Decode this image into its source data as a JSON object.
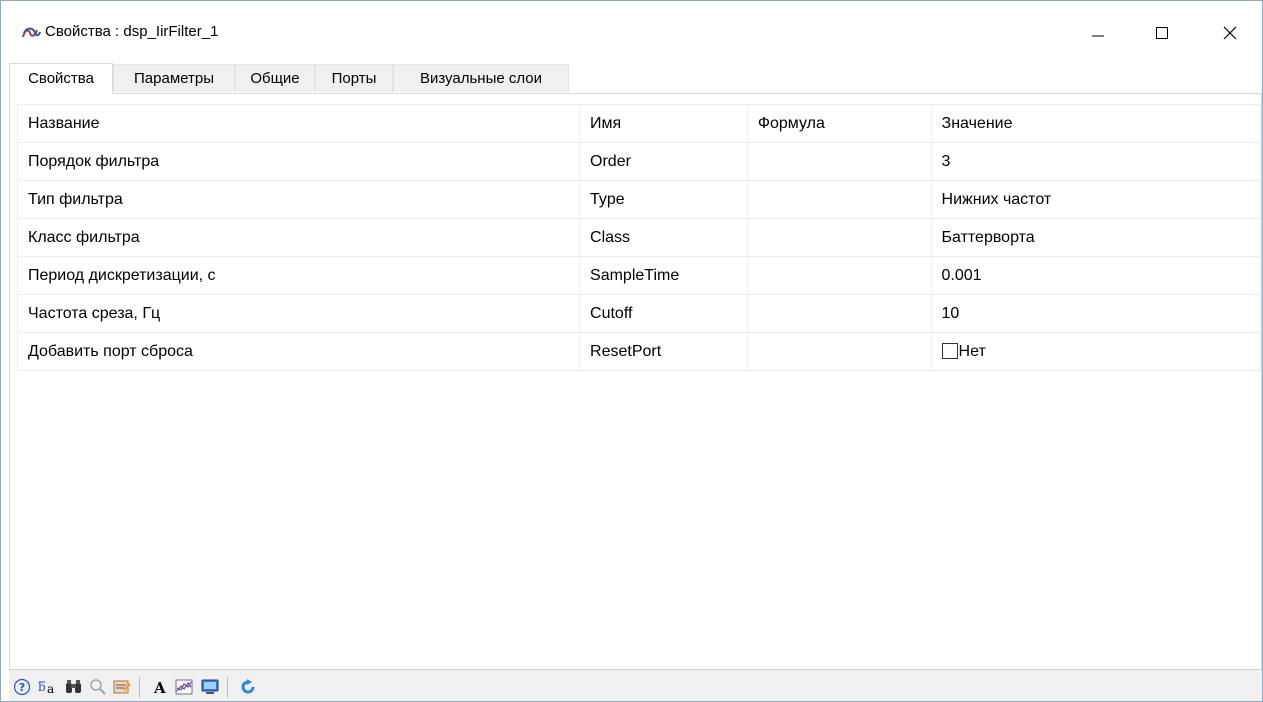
{
  "window": {
    "title": "Свойства : dsp_IirFilter_1"
  },
  "tabs": [
    {
      "label": "Свойства",
      "active": true
    },
    {
      "label": "Параметры",
      "active": false
    },
    {
      "label": "Общие",
      "active": false
    },
    {
      "label": "Порты",
      "active": false
    },
    {
      "label": "Визуальные слои",
      "active": false
    }
  ],
  "grid": {
    "headers": {
      "name": "Название",
      "id": "Имя",
      "formula": "Формула",
      "value": "Значение"
    },
    "rows": [
      {
        "name": "Порядок фильтра",
        "id": "Order",
        "formula": "",
        "value": "3"
      },
      {
        "name": "Тип фильтра",
        "id": "Type",
        "formula": "",
        "value": "Нижних частот"
      },
      {
        "name": "Класс фильтра",
        "id": "Class",
        "formula": "",
        "value": "Баттерворта"
      },
      {
        "name": "Период дискретизации, с",
        "id": "SampleTime",
        "formula": "",
        "value": "0.001"
      },
      {
        "name": "Частота среза, Гц",
        "id": "Cutoff",
        "formula": "",
        "value": "10"
      },
      {
        "name": "Добавить порт сброса",
        "id": "ResetPort",
        "formula": "",
        "value": "Нет",
        "checked": false
      }
    ]
  },
  "toolbar": {
    "icons": [
      "help-icon",
      "sort-icon",
      "binoculars-icon",
      "zoom-icon",
      "settings-icon",
      "font-icon",
      "chart-icon",
      "monitor-icon",
      "refresh-icon"
    ]
  },
  "colors": {
    "tab_bg": "#f0f0f0",
    "grid_line": "#ececec",
    "window_border": "#8fa8c8"
  }
}
